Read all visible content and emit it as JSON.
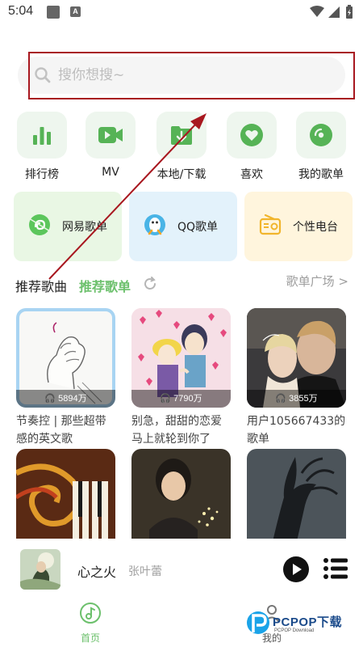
{
  "status_bar": {
    "time": "5:04"
  },
  "search": {
    "placeholder": "搜你想搜~",
    "value": ""
  },
  "quick_nav": [
    {
      "label": "排行榜",
      "icon": "chart-bars-icon"
    },
    {
      "label": "MV",
      "icon": "video-icon"
    },
    {
      "label": "本地/下载",
      "icon": "folder-download-icon"
    },
    {
      "label": "喜欢",
      "icon": "heart-icon"
    },
    {
      "label": "我的歌单",
      "icon": "disc-icon"
    }
  ],
  "sources": [
    {
      "label": "网易歌单",
      "icon": "netease-icon",
      "bg": "#e9f7e4"
    },
    {
      "label": "QQ歌单",
      "icon": "qq-penguin-icon",
      "bg": "#e3f2fb"
    },
    {
      "label": "个性电台",
      "icon": "radio-icon",
      "bg": "#fff5dd"
    }
  ],
  "section": {
    "title": "推荐歌曲",
    "active_tab": "推荐歌单",
    "more": "歌单广场 >"
  },
  "playlists": [
    {
      "count": "5894万",
      "title": "节奏控 | 那些超带感的英文歌"
    },
    {
      "count": "7790万",
      "title": "别急，甜甜的恋爱马上就轮到你了"
    },
    {
      "count": "3855万",
      "title": "用户105667433的歌单"
    },
    {
      "count": "",
      "title": ""
    },
    {
      "count": "",
      "title": ""
    },
    {
      "count": "",
      "title": ""
    }
  ],
  "player": {
    "title": "心之火",
    "artist": "张叶蕾"
  },
  "bottom_nav": [
    {
      "label": "首页",
      "active": true
    },
    {
      "label": "我的",
      "active": false
    }
  ],
  "colors": {
    "accent_green": "#6cc06c",
    "icon_green": "#56b356",
    "highlight_red": "#a8171f"
  },
  "watermark": {
    "brand": "PCPOP下载",
    "sub": "PCPOP Download"
  }
}
